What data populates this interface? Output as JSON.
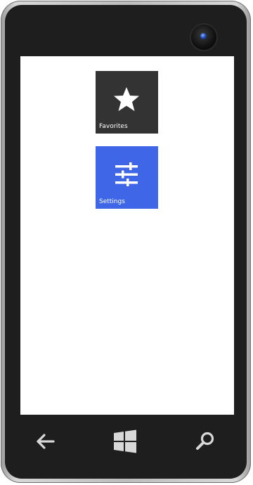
{
  "tiles": [
    {
      "label": "Favorites",
      "icon": "star-icon",
      "color": "#333333"
    },
    {
      "label": "Settings",
      "icon": "sliders-icon",
      "color": "#3f66e6"
    }
  ],
  "nav": {
    "back_icon": "back-arrow-icon",
    "start_icon": "windows-logo-icon",
    "search_icon": "search-icon"
  },
  "device": {
    "frame_color": "#1e1e1e",
    "camera_icon": "camera-icon"
  }
}
